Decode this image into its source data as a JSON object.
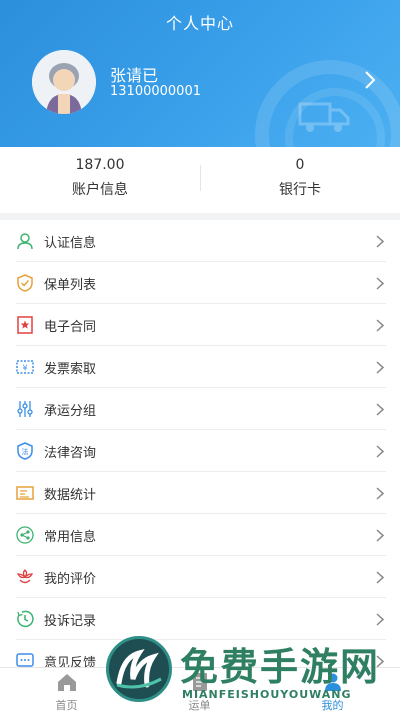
{
  "header": {
    "title": "个人中心",
    "user_name": "张请已",
    "phone": "13100000001"
  },
  "stats": [
    {
      "value": "187.00",
      "label": "账户信息"
    },
    {
      "value": "0",
      "label": "银行卡"
    }
  ],
  "menu": [
    {
      "label": "认证信息",
      "icon": "user-icon",
      "color": "#3cb371"
    },
    {
      "label": "保单列表",
      "icon": "shield-check-icon",
      "color": "#e6a23c"
    },
    {
      "label": "电子合同",
      "icon": "contract-star-icon",
      "color": "#e04040"
    },
    {
      "label": "发票索取",
      "icon": "invoice-icon",
      "color": "#3a8ee6"
    },
    {
      "label": "承运分组",
      "icon": "sliders-icon",
      "color": "#3a8ee6"
    },
    {
      "label": "法律咨询",
      "icon": "law-shield-icon",
      "color": "#3a8ee6"
    },
    {
      "label": "数据统计",
      "icon": "stats-icon",
      "color": "#e6a23c"
    },
    {
      "label": "常用信息",
      "icon": "share-icon",
      "color": "#3cb371"
    },
    {
      "label": "我的评价",
      "icon": "flower-icon",
      "color": "#e04040"
    },
    {
      "label": "投诉记录",
      "icon": "clock-icon",
      "color": "#3cb371"
    },
    {
      "label": "意见反馈",
      "icon": "feedback-icon",
      "color": "#3a8ee6"
    }
  ],
  "tabs": [
    {
      "label": "首页"
    },
    {
      "label": "运单"
    },
    {
      "label": "我的"
    }
  ],
  "watermark": {
    "title": "免费手游网",
    "subtitle": "MIANFEISHOUYOUWANG"
  },
  "colors": {
    "primary": "#2c8fdc",
    "background": "#f2f3f5"
  }
}
